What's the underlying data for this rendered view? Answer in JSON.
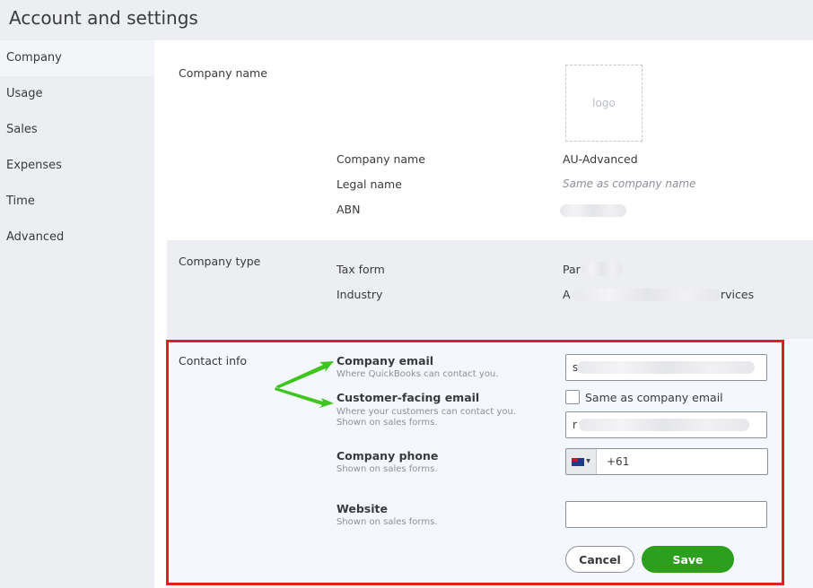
{
  "page": {
    "title": "Account and settings"
  },
  "sidebar": {
    "items": [
      {
        "label": "Company",
        "active": true
      },
      {
        "label": "Usage",
        "active": false
      },
      {
        "label": "Sales",
        "active": false
      },
      {
        "label": "Expenses",
        "active": false
      },
      {
        "label": "Time",
        "active": false
      },
      {
        "label": "Advanced",
        "active": false
      }
    ]
  },
  "company_name_section": {
    "title": "Company name",
    "logo_placeholder": "logo",
    "fields": [
      {
        "label": "Company name",
        "value": "AU-Advanced"
      },
      {
        "label": "Legal name",
        "value": "Same as company name"
      },
      {
        "label": "ABN",
        "value": ""
      }
    ]
  },
  "company_type_section": {
    "title": "Company type",
    "fields": [
      {
        "label": "Tax form",
        "value": "Par"
      },
      {
        "label": "Industry",
        "value_start": "A",
        "value_end": "rvices"
      }
    ]
  },
  "contact_section": {
    "title": "Contact info",
    "company_email": {
      "title": "Company email",
      "help": "Where QuickBooks can contact you.",
      "value": "s"
    },
    "customer_email": {
      "title": "Customer-facing email",
      "help": "Where your customers can contact you. Shown on sales forms.",
      "same_as_label": "Same as company email",
      "value": "r"
    },
    "phone": {
      "title": "Company phone",
      "help": "Shown on sales forms.",
      "value": "+61"
    },
    "website": {
      "title": "Website",
      "help": "Shown on sales forms.",
      "value": ""
    },
    "cancel_label": "Cancel",
    "save_label": "Save"
  },
  "colors": {
    "save_green": "#2ca01c",
    "highlight_red": "#e01e26",
    "arrow_green": "#3ec61e"
  },
  "icons": {
    "flag": "australia-flag-icon",
    "dropdown": "chevron-down-icon"
  }
}
